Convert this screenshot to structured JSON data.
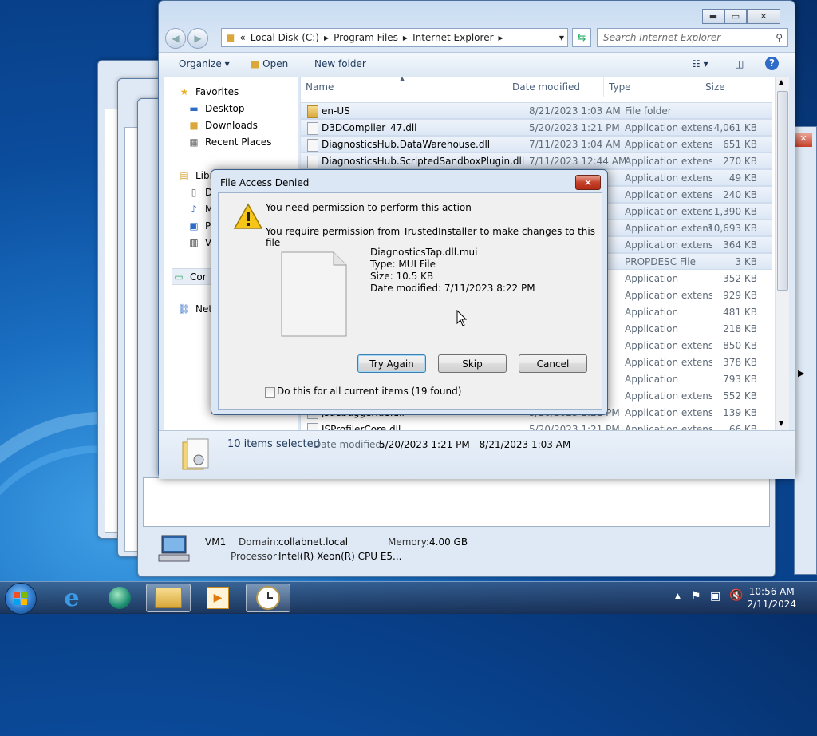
{
  "explorer": {
    "address": [
      "Local Disk (C:)",
      "Program Files",
      "Internet Explorer"
    ],
    "address_prefix": "«",
    "search_placeholder": "Search Internet Explorer",
    "toolbar": {
      "organize": "Organize",
      "open": "Open",
      "new_folder": "New folder"
    },
    "nav": {
      "favorites": "Favorites",
      "desktop": "Desktop",
      "downloads": "Downloads",
      "recent_places": "Recent Places",
      "libraries": "Libr",
      "lib_d": "D",
      "lib_m": "M",
      "lib_p": "P",
      "lib_v": "V",
      "computer": "Cor",
      "network": "Net"
    },
    "columns": {
      "name": "Name",
      "date": "Date modified",
      "type": "Type",
      "size": "Size"
    },
    "files": [
      {
        "name": "en-US",
        "date": "8/21/2023 1:03 AM",
        "type": "File folder",
        "size": "",
        "selected": true,
        "folder": true
      },
      {
        "name": "D3DCompiler_47.dll",
        "date": "5/20/2023 1:21 PM",
        "type": "Application extens...",
        "size": "4,061 KB",
        "selected": true
      },
      {
        "name": "DiagnosticsHub.DataWarehouse.dll",
        "date": "7/11/2023 1:04 AM",
        "type": "Application extens...",
        "size": "651 KB",
        "selected": true
      },
      {
        "name": "DiagnosticsHub.ScriptedSandboxPlugin.dll",
        "date": "7/11/2023 12:44 AM",
        "type": "Application extens...",
        "size": "270 KB",
        "selected": true
      },
      {
        "name": "",
        "date": "",
        "type": "Application extens...",
        "size": "49 KB",
        "selected": true
      },
      {
        "name": "",
        "date": "",
        "type": "Application extens...",
        "size": "240 KB",
        "selected": true
      },
      {
        "name": "",
        "date": "",
        "type": "Application extens...",
        "size": "1,390 KB",
        "selected": true
      },
      {
        "name": "",
        "date": "",
        "type": "Application extens...",
        "size": "10,693 KB",
        "selected": true
      },
      {
        "name": "",
        "date": "",
        "type": "Application extens...",
        "size": "364 KB",
        "selected": true
      },
      {
        "name": "",
        "date": "",
        "type": "PROPDESC File",
        "size": "3 KB",
        "selected": true
      },
      {
        "name": "",
        "date": "",
        "type": "Application",
        "size": "352 KB",
        "selected": false
      },
      {
        "name": "",
        "date": "",
        "type": "Application extens...",
        "size": "929 KB",
        "selected": false
      },
      {
        "name": "",
        "date": "",
        "type": "Application",
        "size": "481 KB",
        "selected": false
      },
      {
        "name": "",
        "date": "",
        "type": "Application",
        "size": "218 KB",
        "selected": false
      },
      {
        "name": "",
        "date": "",
        "type": "Application extens...",
        "size": "850 KB",
        "selected": false
      },
      {
        "name": "",
        "date": "",
        "type": "Application extens...",
        "size": "378 KB",
        "selected": false
      },
      {
        "name": "",
        "date": "",
        "type": "Application",
        "size": "793 KB",
        "selected": false
      },
      {
        "name": "",
        "date": "",
        "type": "Application extens...",
        "size": "552 KB",
        "selected": false
      },
      {
        "name": "jsdebuggeride.dll",
        "date": "5/20/2023 1:21 PM",
        "type": "Application extens...",
        "size": "139 KB",
        "selected": false
      },
      {
        "name": "JSProfilerCore.dll",
        "date": "5/20/2023 1:21 PM",
        "type": "Application extens...",
        "size": "66 KB",
        "selected": false
      }
    ],
    "details": {
      "count": "10 items selected",
      "date_label": "Date modified:",
      "date_range": "5/20/2023 1:21 PM - 8/21/2023 1:03 AM"
    }
  },
  "dialog": {
    "title": "File Access Denied",
    "message": "You need permission to perform this action",
    "submessage": "You require permission from TrustedInstaller to make changes to this file",
    "file_name": "DiagnosticsTap.dll.mui",
    "file_type": "Type: MUI File",
    "file_size": "Size: 10.5 KB",
    "file_date": "Date modified: 7/11/2023 8:22 PM",
    "buttons": {
      "try_again": "Try Again",
      "skip": "Skip",
      "cancel": "Cancel"
    },
    "checkbox_label": "Do this for all current items (19 found)"
  },
  "system_window": {
    "computer_name": "VM1",
    "domain_label": "Domain:",
    "domain": "collabnet.local",
    "memory_label": "Memory:",
    "memory": "4.00 GB",
    "processor_label": "Processor:",
    "processor": "Intel(R) Xeon(R) CPU E5..."
  },
  "taskbar": {
    "time": "10:56 AM",
    "date": "2/11/2024"
  }
}
